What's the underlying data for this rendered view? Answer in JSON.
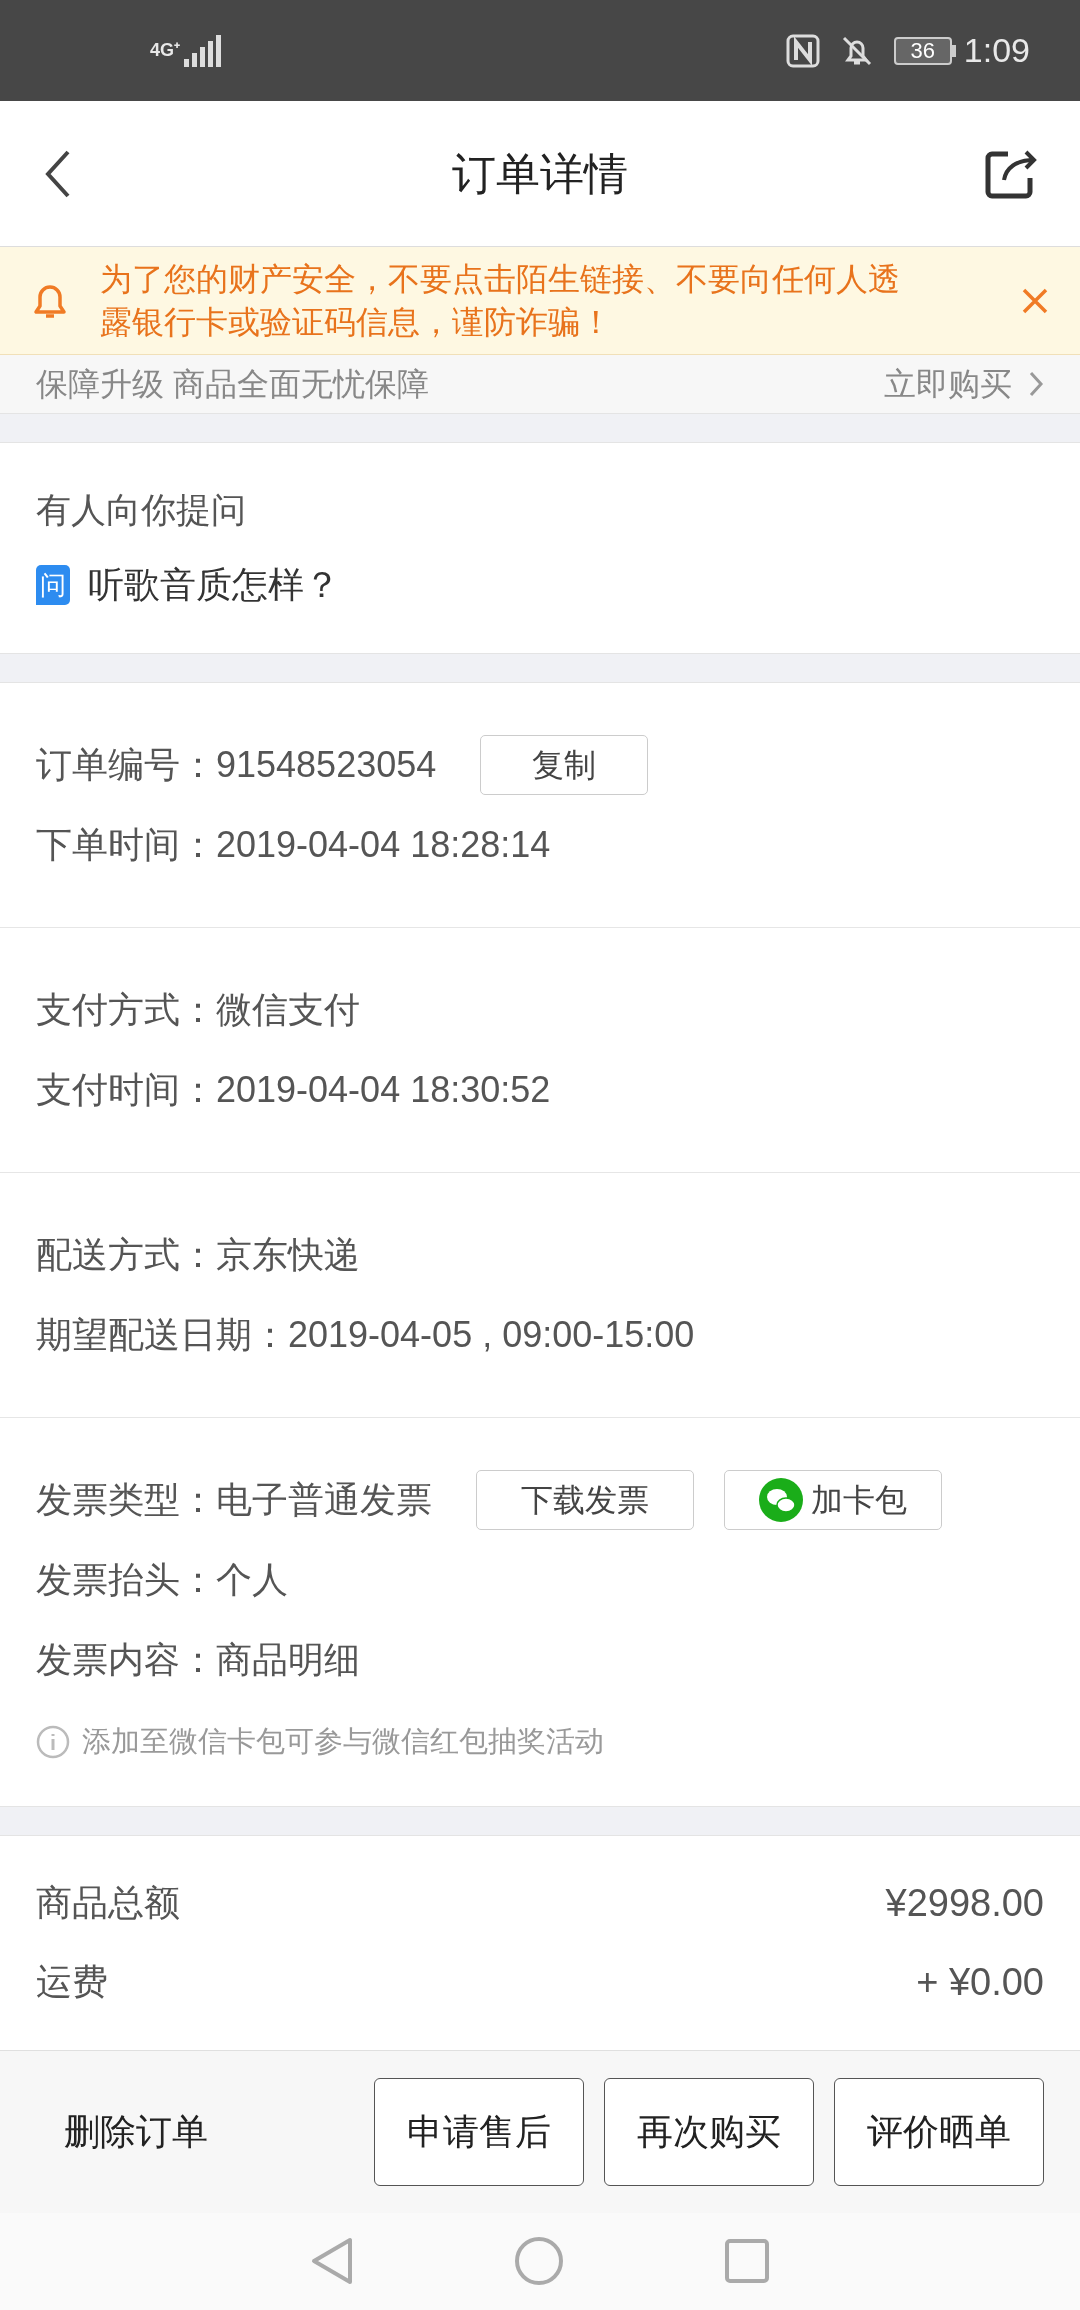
{
  "status_bar": {
    "network": "4G⁺",
    "battery": "36",
    "time": "1:09"
  },
  "header": {
    "title": "订单详情"
  },
  "notice": {
    "text": "为了您的财产安全，不要点击陌生链接、不要向任何人透露银行卡或验证码信息，谨防诈骗！"
  },
  "protection": {
    "text": "保障升级 商品全面无忧保障",
    "action": "立即购买"
  },
  "question": {
    "title": "有人向你提问",
    "badge": "问",
    "text": "听歌音质怎样？"
  },
  "info_sections": [
    {
      "rows": [
        {
          "label": "订单编号：",
          "value": "91548523054",
          "buttons": [
            {
              "kind": "plain",
              "label": "复制"
            }
          ]
        },
        {
          "label": "下单时间：",
          "value": "2019-04-04 18:28:14"
        }
      ]
    },
    {
      "rows": [
        {
          "label": "支付方式：",
          "value": "微信支付"
        },
        {
          "label": "支付时间：",
          "value": "2019-04-04 18:30:52"
        }
      ]
    },
    {
      "rows": [
        {
          "label": "配送方式：",
          "value": "京东快递"
        },
        {
          "label": "期望配送日期：",
          "value": "2019-04-05 , 09:00-15:00"
        }
      ]
    },
    {
      "rows": [
        {
          "label": "发票类型：",
          "value": "电子普通发票",
          "buttons": [
            {
              "kind": "plain",
              "label": "下载发票"
            },
            {
              "kind": "wechat",
              "label": "加卡包"
            }
          ]
        },
        {
          "label": "发票抬头：",
          "value": "个人"
        },
        {
          "label": "发票内容：",
          "value": "商品明细"
        }
      ],
      "hint": "添加至微信卡包可参与微信红包抽奖活动"
    }
  ],
  "totals": [
    {
      "label": "商品总额",
      "value": "¥2998.00"
    },
    {
      "label": "运费",
      "value": "+ ¥0.00"
    }
  ],
  "bottom_bar": {
    "link": "删除订单",
    "buttons": [
      "申请售后",
      "再次购买",
      "评价晒单"
    ]
  }
}
